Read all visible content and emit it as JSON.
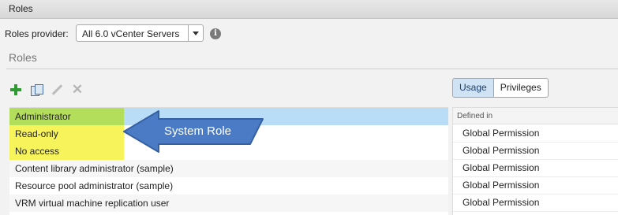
{
  "window": {
    "title": "Roles"
  },
  "provider": {
    "label": "Roles provider:",
    "selected": "All 6.0 vCenter Servers"
  },
  "section": {
    "heading": "Roles"
  },
  "toolbar": {
    "icons": [
      "add-icon",
      "clone-icon",
      "edit-icon",
      "delete-icon"
    ]
  },
  "view_toggle": {
    "usage": "Usage",
    "privileges": "Privileges",
    "active": "Usage"
  },
  "roles": [
    {
      "name": "Administrator"
    },
    {
      "name": "Read-only"
    },
    {
      "name": "No access"
    },
    {
      "name": "Content library administrator (sample)"
    },
    {
      "name": "Resource pool administrator (sample)"
    },
    {
      "name": "VRM virtual machine replication user"
    }
  ],
  "usage": {
    "column": "Defined in",
    "rows": [
      "Global Permission",
      "Global Permission",
      "Global Permission",
      "Global Permission",
      "Global Permission"
    ]
  },
  "annotation": {
    "text": "System Role"
  },
  "colors": {
    "selected_row": "#b9ddf7",
    "highlight_green": "#b3de5b",
    "highlight_yellow": "#f7f35a",
    "callout_blue": "#4a7bc4"
  }
}
